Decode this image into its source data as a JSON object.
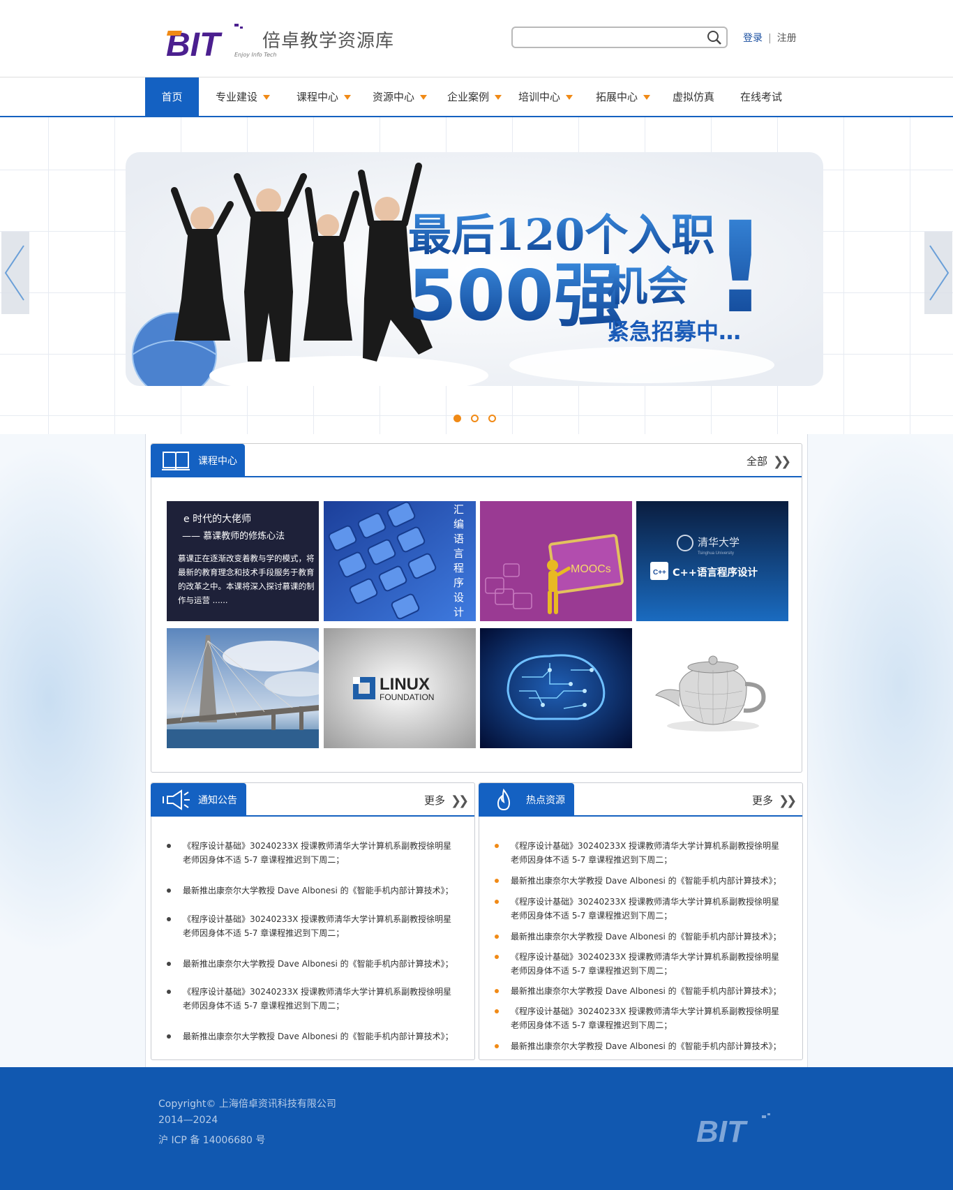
{
  "header": {
    "logo_mark": "BIT",
    "logo_title": "倍卓教学资源库",
    "logo_subtitle": "Enjoy Info Tech",
    "search_placeholder": "",
    "login": "登录",
    "register": "注册"
  },
  "nav": {
    "items": [
      {
        "label": "首页",
        "dropdown": false
      },
      {
        "label": "专业建设",
        "dropdown": true
      },
      {
        "label": "课程中心",
        "dropdown": true
      },
      {
        "label": "资源中心",
        "dropdown": true
      },
      {
        "label": "企业案例",
        "dropdown": true
      },
      {
        "label": "培训中心",
        "dropdown": true
      },
      {
        "label": "拓展中心",
        "dropdown": true
      },
      {
        "label": "虚拟仿真",
        "dropdown": false
      },
      {
        "label": "在线考试",
        "dropdown": false
      }
    ],
    "active_index": 0,
    "accent_color": "#1461c2",
    "arrow_color": "#f08a16"
  },
  "banner": {
    "headline_1": "最后120个入职",
    "headline_big": "500强",
    "headline_2": "机会",
    "headline_3": "紧急招募中…",
    "exclamation": "!",
    "slides": 3,
    "active_slide": 0
  },
  "courses": {
    "title": "课程中心",
    "more": "全部",
    "tiles": [
      {
        "icon": "mooc-teacher-card",
        "title": "e 时代的大佬师",
        "subtitle": "—— 慕课教师的修炼心法",
        "desc": "慕课正在逐渐改变着教与学的模式，将最新的教育理念和技术手段服务于教育的改革之中。本课将深入探讨慕课的制作与运营 ......"
      },
      {
        "icon": "keyboard-image",
        "vertical_text": "汇编语言程序设计"
      },
      {
        "icon": "moocs-figure-image",
        "label": "MOOCs"
      },
      {
        "icon": "tsinghua-cpp-image",
        "school": "清华大学",
        "school_en": "Tsinghua University",
        "label": "C++语言程序设计",
        "badge": "C++"
      },
      {
        "icon": "bridge-image"
      },
      {
        "icon": "linux-foundation-image",
        "line1": "LINUX",
        "line2": "FOUNDATION"
      },
      {
        "icon": "circuit-brain-image"
      },
      {
        "icon": "teapot-image"
      }
    ]
  },
  "notices": {
    "title": "通知公告",
    "more": "更多",
    "items": [
      "《程序设计基础》30240233X 授课教师清华大学计算机系副教授徐明星老师因身体不适 5-7 章课程推迟到下周二；",
      "最新推出康奈尔大学教授 Dave Albonesi 的《智能手机内部计算技术》；",
      "《程序设计基础》30240233X 授课教师清华大学计算机系副教授徐明星老师因身体不适 5-7 章课程推迟到下周二；",
      "最新推出康奈尔大学教授 Dave Albonesi 的《智能手机内部计算技术》；",
      "《程序设计基础》30240233X 授课教师清华大学计算机系副教授徐明星老师因身体不适 5-7 章课程推迟到下周二；",
      "最新推出康奈尔大学教授 Dave Albonesi 的《智能手机内部计算技术》；"
    ]
  },
  "hot": {
    "title": "热点资源",
    "more": "更多",
    "items": [
      "《程序设计基础》30240233X 授课教师清华大学计算机系副教授徐明星老师因身体不适 5-7 章课程推迟到下周二；",
      "最新推出康奈尔大学教授 Dave Albonesi 的《智能手机内部计算技术》；",
      "《程序设计基础》30240233X 授课教师清华大学计算机系副教授徐明星老师因身体不适 5-7 章课程推迟到下周二；",
      "最新推出康奈尔大学教授 Dave Albonesi 的《智能手机内部计算技术》；",
      "《程序设计基础》30240233X 授课教师清华大学计算机系副教授徐明星老师因身体不适 5-7 章课程推迟到下周二；",
      "最新推出康奈尔大学教授 Dave Albonesi 的《智能手机内部计算技术》；",
      "《程序设计基础》30240233X 授课教师清华大学计算机系副教授徐明星老师因身体不适 5-7 章课程推迟到下周二；",
      "最新推出康奈尔大学教授 Dave Albonesi 的《智能手机内部计算技术》；"
    ],
    "bullet_color": "#f08a16"
  },
  "footer": {
    "copyright": "Copyright© 上海倍卓资讯科技有限公司",
    "years": "2014—2024",
    "icp": "沪 ICP 备 14006680 号",
    "logo": "BIT",
    "bg_color": "#1158b0"
  }
}
